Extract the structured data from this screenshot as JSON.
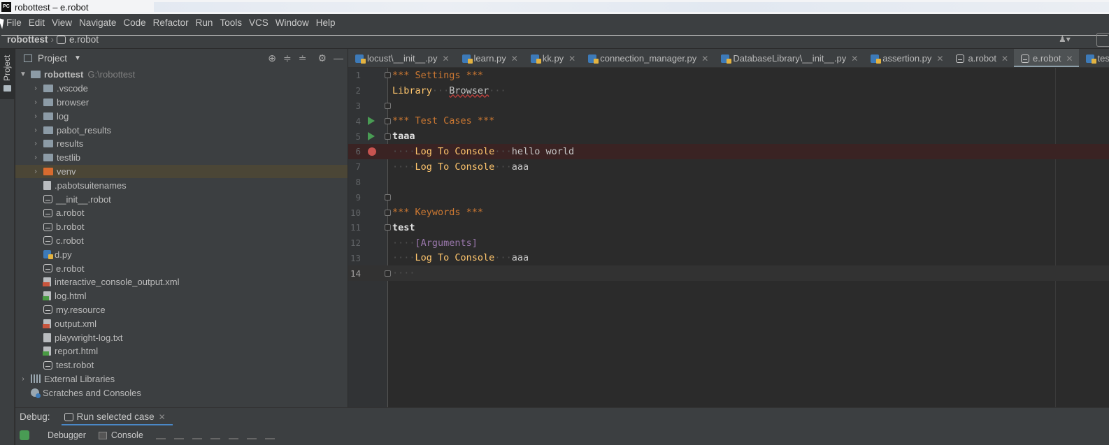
{
  "window": {
    "title": "robottest – e.robot",
    "app_icon": "PC"
  },
  "menu": [
    "File",
    "Edit",
    "View",
    "Navigate",
    "Code",
    "Refactor",
    "Run",
    "Tools",
    "VCS",
    "Window",
    "Help"
  ],
  "navbar": {
    "project": "robottest",
    "file": "e.robot"
  },
  "sidebar": {
    "project_tab": "Project"
  },
  "project_panel": {
    "title": "Project",
    "root": {
      "name": "robottest",
      "path": "G:\\robottest"
    },
    "items": [
      {
        "name": ".vscode",
        "type": "folder"
      },
      {
        "name": "browser",
        "type": "folder"
      },
      {
        "name": "log",
        "type": "folder"
      },
      {
        "name": "pabot_results",
        "type": "folder"
      },
      {
        "name": "results",
        "type": "folder"
      },
      {
        "name": "testlib",
        "type": "folder"
      },
      {
        "name": "venv",
        "type": "folder-excluded"
      },
      {
        "name": ".pabotsuitenames",
        "type": "file"
      },
      {
        "name": "__init__.robot",
        "type": "robot"
      },
      {
        "name": "a.robot",
        "type": "robot"
      },
      {
        "name": "b.robot",
        "type": "robot"
      },
      {
        "name": "c.robot",
        "type": "robot"
      },
      {
        "name": "d.py",
        "type": "python"
      },
      {
        "name": "e.robot",
        "type": "robot"
      },
      {
        "name": "interactive_console_output.xml",
        "type": "xml"
      },
      {
        "name": "log.html",
        "type": "html"
      },
      {
        "name": "my.resource",
        "type": "robot"
      },
      {
        "name": "output.xml",
        "type": "xml"
      },
      {
        "name": "playwright-log.txt",
        "type": "file"
      },
      {
        "name": "report.html",
        "type": "html"
      },
      {
        "name": "test.robot",
        "type": "robot"
      }
    ],
    "external_libraries": "External Libraries",
    "scratches": "Scratches and Consoles"
  },
  "tabs": [
    {
      "label": "locust\\__init__.py",
      "icon": "python-icon"
    },
    {
      "label": "learn.py",
      "icon": "python-icon"
    },
    {
      "label": "kk.py",
      "icon": "python-icon"
    },
    {
      "label": "connection_manager.py",
      "icon": "python-icon"
    },
    {
      "label": "DatabaseLibrary\\__init__.py",
      "icon": "python-icon"
    },
    {
      "label": "assertion.py",
      "icon": "python-icon"
    },
    {
      "label": "a.robot",
      "icon": "robot-icon"
    },
    {
      "label": "e.robot",
      "icon": "robot-icon",
      "active": true
    },
    {
      "label": "testlib.",
      "icon": "python-icon"
    }
  ],
  "editor": {
    "line_numbers": [
      "1",
      "2",
      "3",
      "4",
      "5",
      "6",
      "7",
      "8",
      "9",
      "10",
      "11",
      "12",
      "13",
      "14"
    ],
    "code": {
      "settings_header": "*** Settings ***",
      "library_kw": "Library",
      "library_name": "Browser",
      "testcases_header": "*** Test Cases ***",
      "testcase_name": "taaa",
      "kw_log1": "Log To Console",
      "arg_hello": "hello world",
      "kw_log2": "Log To Console",
      "arg_aaa1": "aaa",
      "keywords_header": "*** Keywords ***",
      "keyword_name": "test",
      "arguments_setting": "[Arguments]",
      "kw_log3": "Log To Console",
      "arg_aaa2": "aaa"
    }
  },
  "debug": {
    "label": "Debug:",
    "config": "Run selected case",
    "debugger_tab": "Debugger",
    "console_tab": "Console"
  },
  "colors": {
    "section": "#cc7832",
    "keyword": "#ffc66d",
    "breakpoint": "#c75450",
    "run_gutter": "#499c54"
  }
}
